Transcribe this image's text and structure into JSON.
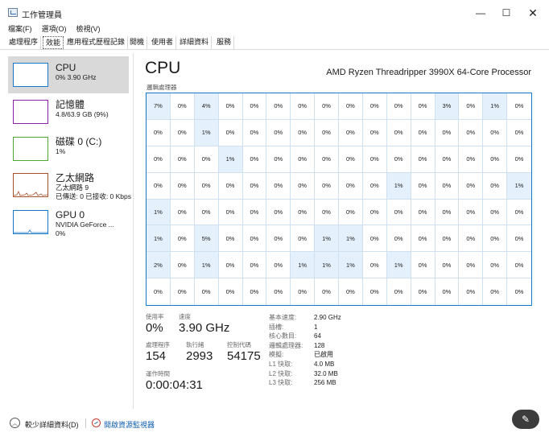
{
  "window": {
    "title": "工作管理員",
    "min_glyph": "—",
    "max_glyph": "☐",
    "close_glyph": "✕"
  },
  "menu": [
    "檔案(F)",
    "選項(O)",
    "檢視(V)"
  ],
  "tabs": [
    "處理程序",
    "效能",
    "應用程式歷程記錄",
    "開機",
    "使用者",
    "詳細資料",
    "服務"
  ],
  "sidebar": {
    "items": [
      {
        "name": "CPU",
        "sub1": "0% 3.90 GHz",
        "sub2": "",
        "color": "#1778c8"
      },
      {
        "name": "記憶體",
        "sub1": "4.8/63.9 GB (9%)",
        "sub2": "",
        "color": "#8b1fa9"
      },
      {
        "name": "磁碟 0 (C:)",
        "sub1": "1%",
        "sub2": "",
        "color": "#4da62f"
      },
      {
        "name": "乙太網路",
        "sub1": "乙太網路 9",
        "sub2": "已傳送: 0 已接收: 0 Kbps",
        "color": "#a7512a"
      },
      {
        "name": "GPU 0",
        "sub1": "NVIDIA GeForce ...",
        "sub2": "0%",
        "color": "#1778c8"
      }
    ]
  },
  "main": {
    "title": "CPU",
    "model": "AMD Ryzen Threadripper 3990X 64-Core Processor",
    "grid_label": "邏輯處理器",
    "cores": [
      "7%",
      "0%",
      "4%",
      "0%",
      "0%",
      "0%",
      "0%",
      "0%",
      "0%",
      "0%",
      "0%",
      "0%",
      "3%",
      "0%",
      "1%",
      "0%",
      "0%",
      "0%",
      "1%",
      "0%",
      "0%",
      "0%",
      "0%",
      "0%",
      "0%",
      "0%",
      "0%",
      "0%",
      "0%",
      "0%",
      "0%",
      "0%",
      "0%",
      "0%",
      "0%",
      "1%",
      "0%",
      "0%",
      "0%",
      "0%",
      "0%",
      "0%",
      "0%",
      "0%",
      "0%",
      "0%",
      "0%",
      "0%",
      "0%",
      "0%",
      "0%",
      "0%",
      "0%",
      "0%",
      "0%",
      "0%",
      "0%",
      "0%",
      "1%",
      "0%",
      "0%",
      "0%",
      "0%",
      "1%",
      "1%",
      "0%",
      "0%",
      "0%",
      "0%",
      "0%",
      "0%",
      "0%",
      "0%",
      "0%",
      "0%",
      "0%",
      "0%",
      "0%",
      "0%",
      "0%",
      "1%",
      "0%",
      "5%",
      "0%",
      "0%",
      "0%",
      "0%",
      "1%",
      "1%",
      "0%",
      "0%",
      "0%",
      "0%",
      "0%",
      "0%",
      "0%",
      "2%",
      "0%",
      "1%",
      "0%",
      "0%",
      "0%",
      "1%",
      "1%",
      "1%",
      "0%",
      "1%",
      "0%",
      "0%",
      "0%",
      "0%",
      "0%",
      "0%",
      "0%",
      "0%",
      "0%",
      "0%",
      "0%",
      "0%",
      "0%",
      "0%",
      "0%",
      "0%",
      "0%",
      "0%",
      "0%",
      "0%",
      "0%"
    ]
  },
  "stats": {
    "utilization_label": "使用率",
    "utilization": "0%",
    "speed_label": "速度",
    "speed": "3.90 GHz",
    "processes_label": "處理程序",
    "processes": "154",
    "threads_label": "執行緒",
    "threads": "2993",
    "handles_label": "控制代碼",
    "handles": "54175",
    "uptime_label": "運作時間",
    "uptime": "0:00:04:31"
  },
  "specs": [
    {
      "k": "基本速度:",
      "v": "2.90 GHz"
    },
    {
      "k": "插槽:",
      "v": "1"
    },
    {
      "k": "核心數目:",
      "v": "64"
    },
    {
      "k": "邏輯處理器:",
      "v": "128"
    },
    {
      "k": "模擬:",
      "v": "已啟用"
    },
    {
      "k": "L1 快取:",
      "v": "4.0 MB"
    },
    {
      "k": "L2 快取:",
      "v": "32.0 MB"
    },
    {
      "k": "L3 快取:",
      "v": "256 MB"
    }
  ],
  "footer": {
    "fewer_details": "較少詳細資料(D)",
    "open_resmon": "開啟資源監視器",
    "fewer_glyph": "︿",
    "fab_glyph": "✎"
  },
  "colors": {
    "accent": "#1778c8",
    "highlight": "#e4f0fb"
  }
}
